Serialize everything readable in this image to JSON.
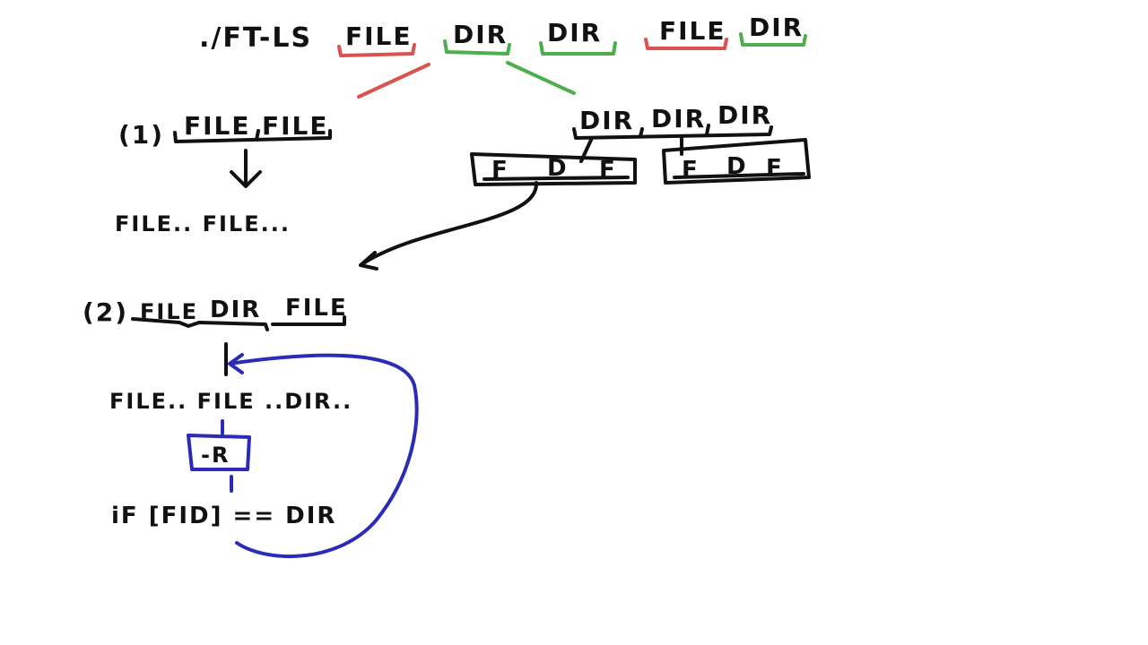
{
  "colors": {
    "ink": "#111111",
    "red": "#d9534f",
    "green": "#4cae4c",
    "blue": "#2b2bb8"
  },
  "top": {
    "command": "./FT-LS",
    "tokens": [
      "FILE",
      "DIR",
      "DIR",
      "FILE",
      "DIR"
    ]
  },
  "case1": {
    "label": "(1)",
    "items": [
      "FILE",
      "FILE"
    ],
    "result": "FILE.. FILE..."
  },
  "dirs": {
    "items": [
      "DIR",
      "DIR",
      "DIR"
    ],
    "box1": [
      "F",
      "D",
      "F"
    ],
    "box2": [
      "F",
      "D",
      "F"
    ]
  },
  "case2": {
    "label": "(2)",
    "items": [
      "FILE",
      "DIR",
      "FILE"
    ],
    "result": "FILE.. FILE ..DIR..",
    "flag": "-R",
    "condition": "iF [FID] == DIR"
  }
}
